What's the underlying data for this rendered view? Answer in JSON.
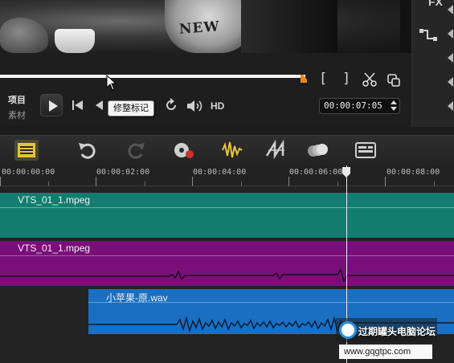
{
  "preview": {
    "shirt_text": "NEW"
  },
  "fx_panel": {
    "label": "FX"
  },
  "controls": {
    "mode_project": "项目",
    "mode_clip": "素材",
    "mark_in": "[",
    "mark_out": "]",
    "hd_label": "HD",
    "timecode": "00:00:07:05",
    "tooltip": "修整标记"
  },
  "ruler": {
    "labels": [
      "00:00:00:00",
      "00:00:02:00",
      "00:00:04:00",
      "00:00:06:00",
      "00:00:08:00"
    ]
  },
  "tracks": {
    "video_clip": "VTS_01_1.mpeg",
    "audio_clip": "VTS_01_1.mpeg",
    "music_clip": "小苹果-原.wav"
  },
  "colors": {
    "video_track": "#137d71",
    "audio_track": "#7a0f7a",
    "music_track": "#1a6fc2",
    "trim_marker": "#e5892f"
  },
  "watermark": {
    "title": "过期罐头电脑论坛",
    "url": "www.gqgtpc.com"
  }
}
